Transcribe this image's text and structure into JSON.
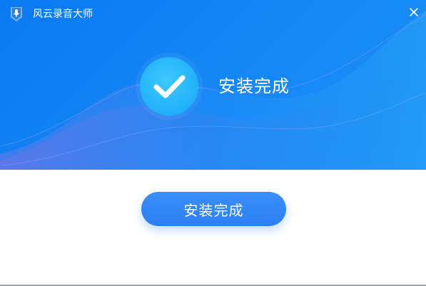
{
  "window": {
    "title": "风云录音大师",
    "icons": {
      "app": "microphone-icon",
      "close": "close-icon",
      "success": "checkmark-icon"
    }
  },
  "header": {
    "status_text": "安装完成",
    "colors": {
      "background": "#0a79f3",
      "success_circle": "#25b4fb"
    }
  },
  "footer": {
    "finish_button_label": "安装完成",
    "colors": {
      "button": "#2b7ff5"
    }
  }
}
